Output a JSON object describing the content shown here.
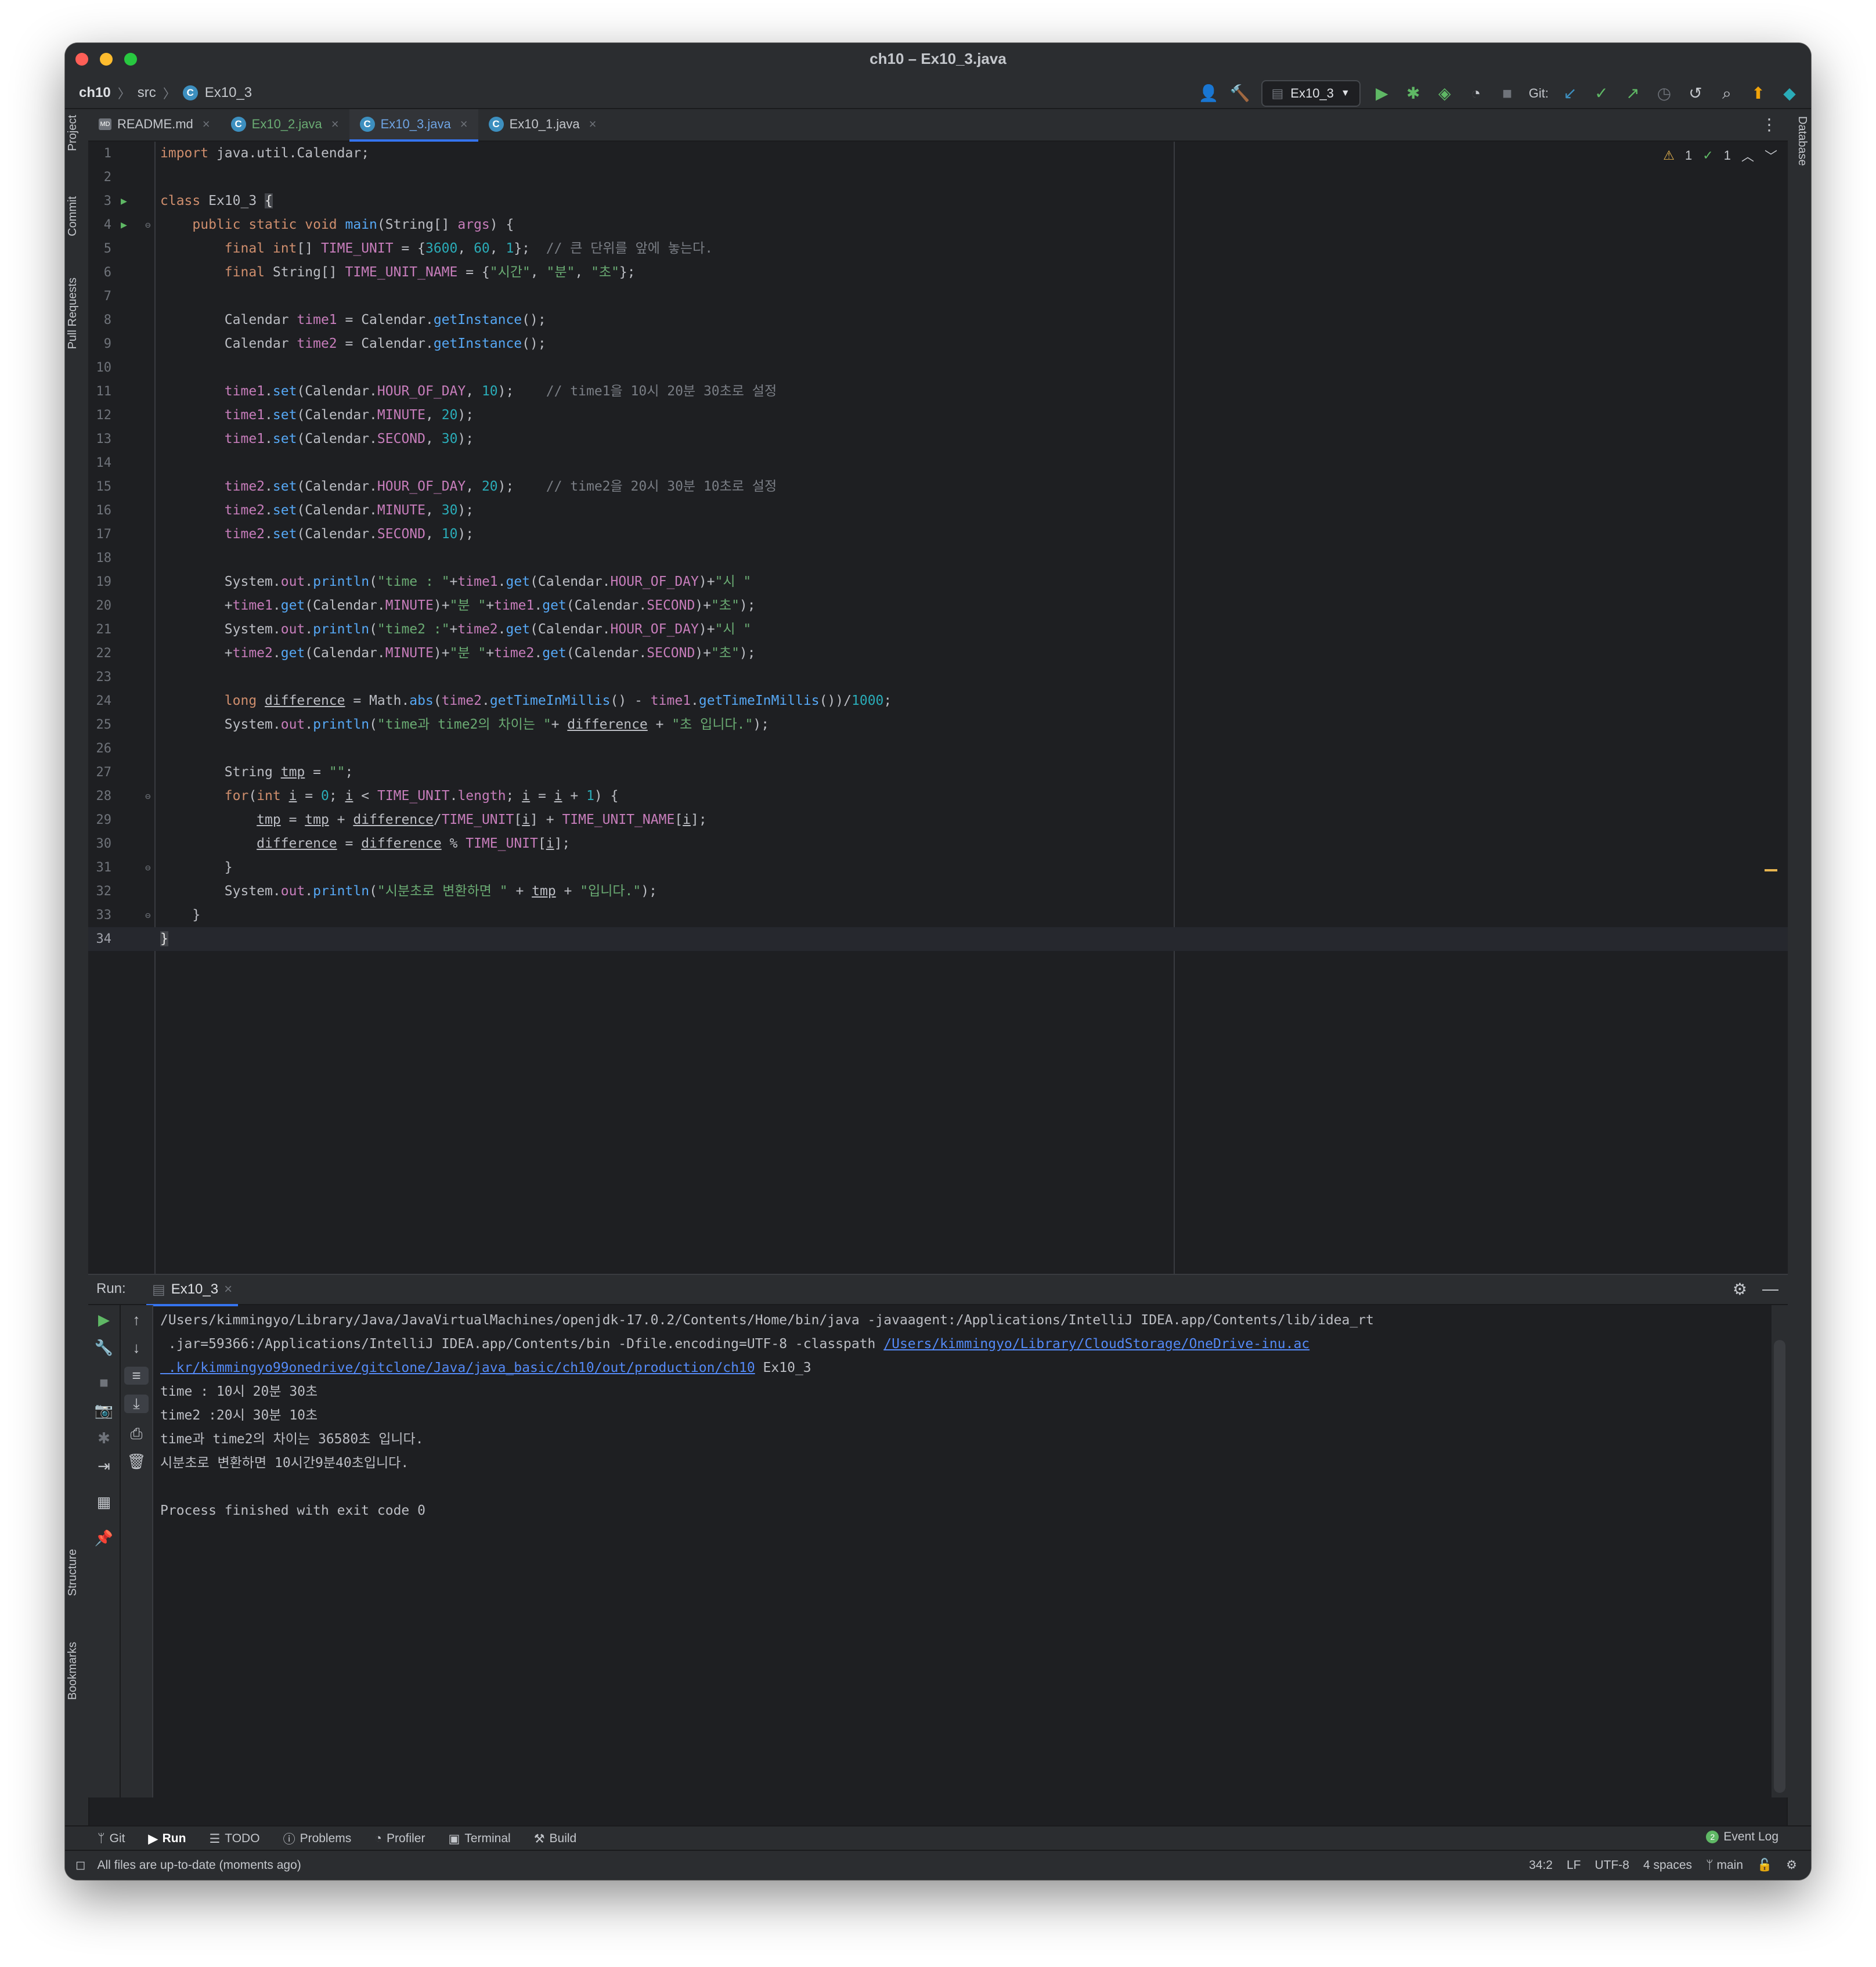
{
  "window": {
    "title": "ch10 – Ex10_3.java"
  },
  "breadcrumb": {
    "project": "ch10",
    "folder": "src",
    "file": "Ex10_3"
  },
  "toolbar": {
    "run_config": "Ex10_3",
    "git_label": "Git:"
  },
  "tabs": [
    {
      "label": "README.md"
    },
    {
      "label": "Ex10_2.java"
    },
    {
      "label": "Ex10_3.java"
    },
    {
      "label": "Ex10_1.java"
    }
  ],
  "left_tools": {
    "project": "Project",
    "commit": "Commit",
    "pull_requests": "Pull Requests",
    "structure": "Structure",
    "bookmarks": "Bookmarks"
  },
  "right_tools": {
    "database": "Database"
  },
  "inspections": {
    "warnings": "1",
    "typos": "1"
  },
  "editor": {
    "line_numbers": [
      "1",
      "2",
      "3",
      "4",
      "5",
      "6",
      "7",
      "8",
      "9",
      "10",
      "11",
      "12",
      "13",
      "14",
      "15",
      "16",
      "17",
      "18",
      "19",
      "20",
      "21",
      "22",
      "23",
      "24",
      "25",
      "26",
      "27",
      "28",
      "29",
      "30",
      "31",
      "32",
      "33",
      "34"
    ],
    "comments": {
      "c5": "// 큰 단위를 앞에 놓는다.",
      "c11": "// time1을 10시 20분 30초로 설정",
      "c15": "// time2을 20시 30분 10초로 설정"
    }
  },
  "run": {
    "label": "Run:",
    "tab": "Ex10_3",
    "console": {
      "l1": "/Users/kimmingyo/Library/Java/JavaVirtualMachines/openjdk-17.0.2/Contents/Home/bin/java -javaagent:/Applications/IntelliJ IDEA.app/Contents/lib/idea_rt",
      "l2_a": " .jar=59366:/Applications/IntelliJ IDEA.app/Contents/bin -Dfile.encoding=UTF-8 -classpath ",
      "l2_link": "/Users/kimmingyo/Library/CloudStorage/OneDrive-inu.ac",
      "l3_link": " .kr/kimmingyo99onedrive/gitclone/Java/java_basic/ch10/out/production/ch10",
      "l3_b": " Ex10_3",
      "l4": "time : 10시 20분 30초",
      "l5": "time2 :20시 30분 10초",
      "l6": "time과 time2의 차이는 36580초 입니다.",
      "l7": "시분초로 변환하면 10시간9분40초입니다.",
      "l9": "Process finished with exit code 0"
    }
  },
  "bottom_tabs": {
    "git": "Git",
    "run": "Run",
    "todo": "TODO",
    "problems": "Problems",
    "profiler": "Profiler",
    "terminal": "Terminal",
    "build": "Build",
    "event_log": "Event Log",
    "event_count": "2"
  },
  "status": {
    "message": "All files are up-to-date (moments ago)",
    "position": "34:2",
    "line_sep": "LF",
    "encoding": "UTF-8",
    "indent": "4 spaces",
    "branch": "main"
  },
  "colors": {
    "keyword": "#cf8e6d",
    "field": "#c77dbb",
    "string": "#6aab73",
    "number": "#2aacb8",
    "method": "#56a8f5",
    "accent": "#3574f0"
  }
}
